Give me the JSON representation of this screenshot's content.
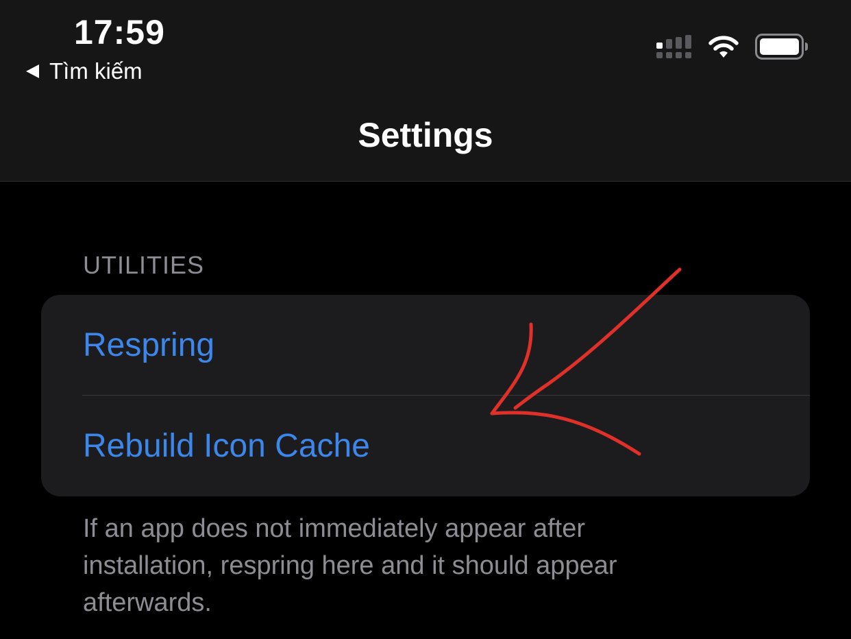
{
  "status_bar": {
    "time": "17:59",
    "back_label": "Tìm kiếm",
    "signal_icon": "cellular-signal-icon",
    "wifi_icon": "wifi-icon",
    "battery_icon": "battery-icon"
  },
  "nav": {
    "title": "Settings"
  },
  "section": {
    "header": "UTILITIES",
    "items": [
      {
        "label": "Respring"
      },
      {
        "label": "Rebuild Icon Cache"
      }
    ],
    "footer": "If an app does not immediately appear after installation, respring here and it should appear afterwards."
  },
  "colors": {
    "accent": "#3d87ea",
    "background": "#000000",
    "header_bg": "#161616",
    "cell_bg": "#1c1c1e",
    "secondary_text": "#8d8d93",
    "annotation": "#e0302a"
  }
}
